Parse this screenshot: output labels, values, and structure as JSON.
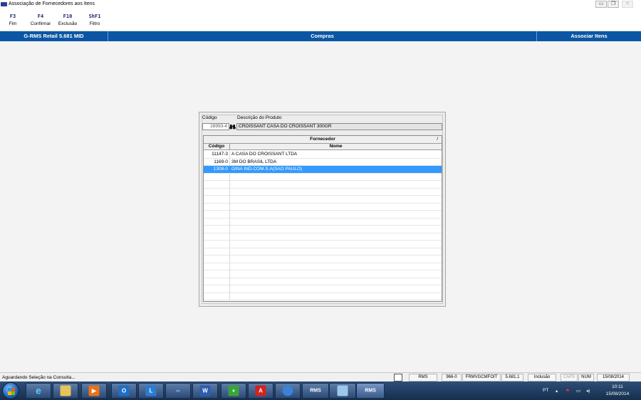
{
  "window": {
    "title": "Associação de Fornecedores aos Itens",
    "controls": {
      "minimize": "▭",
      "maximize": "❐",
      "close": "✕"
    }
  },
  "toolbar": {
    "keys": [
      {
        "key": "F3",
        "label": "Fim"
      },
      {
        "key": "F4",
        "label": "Confirmar"
      },
      {
        "key": "F10",
        "label": "Exclusão"
      },
      {
        "key": "ShF1",
        "label": "Filtro"
      }
    ]
  },
  "header": {
    "system": "G-RMS Retail 5.681 MID",
    "module": "Compras",
    "screen": "Associar Itens",
    "color": "#0b56a4"
  },
  "form": {
    "codigo_label": "Código",
    "descricao_label": "Descrição do Produto",
    "codigo_value": "28993-4",
    "descricao_value": "CROISSANT CASA DO CROISSANT 300GR",
    "search_icon": "binoculars-icon"
  },
  "grid": {
    "group_header": "Fornecedor",
    "slash": "/",
    "col_codigo": "Código",
    "col_nome": "Nome",
    "rows": [
      {
        "codigo": "11147-3",
        "nome": "A CASA DO CROISSANT LTDA"
      },
      {
        "codigo": "1169-0",
        "nome": "3M DO BRASIL LTDA"
      },
      {
        "codigo": "1308-0",
        "nome": "GINA IND.COM.S.A(SAO PAULO)",
        "selected": true
      }
    ],
    "selection_color": "#3399ff"
  },
  "status": {
    "message": "Aguardando Seleção na Consulta...",
    "cells": [
      "RMS",
      "966-0",
      "FRMVGCMFOIT",
      "5.681.1",
      "Inclusão",
      "CAPS",
      "NUM",
      "15/08/2014"
    ]
  },
  "taskbar": {
    "apps": [
      "ie-icon",
      "explorer-icon",
      "media-player-icon",
      "outlook-icon",
      "lync-icon",
      "link-icon",
      "word-icon",
      "app-icon",
      "acrobat-icon",
      "globe-icon",
      "rms-icon",
      "window-icon",
      "rms-icon"
    ],
    "app_labels": [
      "RMS",
      "RMS"
    ],
    "lang": "PT",
    "time": "10:11",
    "date": "15/08/2014"
  }
}
